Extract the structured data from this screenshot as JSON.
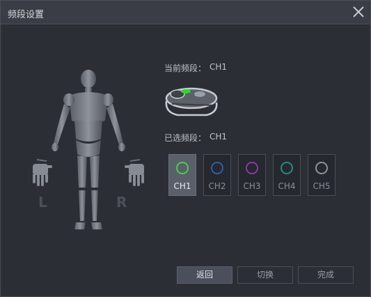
{
  "window": {
    "title": "频段设置"
  },
  "figure": {
    "left_label": "L",
    "right_label": "R"
  },
  "current": {
    "label": "当前频段：",
    "value": "CH1"
  },
  "selected": {
    "label": "已选频段：",
    "value": "CH1"
  },
  "channels": [
    {
      "label": "CH1",
      "color": "#3dd63d",
      "active": true
    },
    {
      "label": "CH2",
      "color": "#2f5fa8",
      "active": false
    },
    {
      "label": "CH3",
      "color": "#8a3aa0",
      "active": false
    },
    {
      "label": "CH4",
      "color": "#1e8e80",
      "active": false
    },
    {
      "label": "CH5",
      "color": "#8f9297",
      "active": false
    }
  ],
  "buttons": {
    "back": "返回",
    "switch": "切换",
    "done": "完成"
  }
}
